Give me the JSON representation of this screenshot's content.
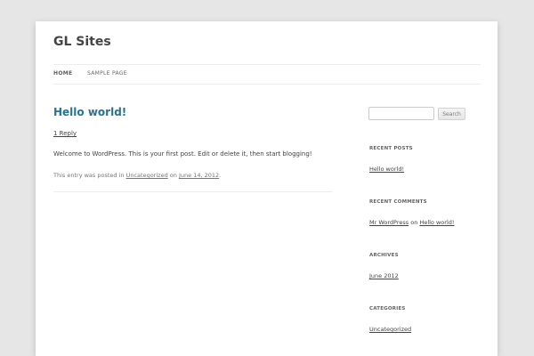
{
  "site": {
    "title": "GL Sites"
  },
  "nav": {
    "items": [
      {
        "label": "HOME"
      },
      {
        "label": "SAMPLE PAGE"
      }
    ]
  },
  "post": {
    "title": "Hello world!",
    "reply_label": "1 Reply",
    "body": "Welcome to WordPress. This is your first post. Edit or delete it, then start blogging!",
    "meta_prefix": "This entry was posted in",
    "category": "Uncategorized",
    "meta_on": "on",
    "date": "June 14, 2012",
    "meta_suffix": "."
  },
  "sidebar": {
    "search": {
      "placeholder": "",
      "button_label": "Search"
    },
    "recent_posts": {
      "title": "RECENT POSTS",
      "items": [
        "Hello world!"
      ]
    },
    "recent_comments": {
      "title": "RECENT COMMENTS",
      "author": "Mr WordPress",
      "on": "on",
      "post": "Hello world!"
    },
    "archives": {
      "title": "ARCHIVES",
      "items": [
        "June 2012"
      ]
    },
    "categories": {
      "title": "CATEGORIES",
      "items": [
        "Uncategorized"
      ]
    }
  },
  "colors": {
    "background": "#e6e6e6",
    "page": "#ffffff",
    "link_accent": "#21759b",
    "text": "#444444"
  }
}
